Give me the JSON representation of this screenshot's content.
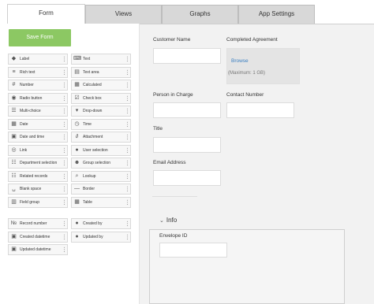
{
  "tabs": [
    {
      "label": "Form",
      "active": true
    },
    {
      "label": "Views",
      "active": false
    },
    {
      "label": "Graphs",
      "active": false
    },
    {
      "label": "App Settings",
      "active": false
    }
  ],
  "save_button": "Save Form",
  "palette": [
    {
      "label": "Label",
      "icon": "tag-icon"
    },
    {
      "label": "Text",
      "icon": "text-icon"
    },
    {
      "label": "Rich text",
      "icon": "rich-text-icon"
    },
    {
      "label": "Text area",
      "icon": "text-area-icon"
    },
    {
      "label": "Number",
      "icon": "number-icon"
    },
    {
      "label": "Calculated",
      "icon": "calculator-icon"
    },
    {
      "label": "Radio button",
      "icon": "radio-icon"
    },
    {
      "label": "Check box",
      "icon": "checkbox-icon"
    },
    {
      "label": "Multi-choice",
      "icon": "list-icon"
    },
    {
      "label": "Drop-down",
      "icon": "dropdown-icon"
    },
    {
      "label": "Date",
      "icon": "calendar-icon"
    },
    {
      "label": "Time",
      "icon": "clock-icon"
    },
    {
      "label": "Date and time",
      "icon": "calendar-clock-icon"
    },
    {
      "label": "Attachment",
      "icon": "paperclip-icon"
    },
    {
      "label": "Link",
      "icon": "globe-icon"
    },
    {
      "label": "User selection",
      "icon": "user-icon"
    },
    {
      "label": "Department selection",
      "icon": "department-icon"
    },
    {
      "label": "Group selection",
      "icon": "group-icon"
    },
    {
      "label": "Related records",
      "icon": "related-records-icon"
    },
    {
      "label": "Lookup",
      "icon": "lookup-icon"
    },
    {
      "label": "Blank space",
      "icon": "blank-space-icon"
    },
    {
      "label": "Border",
      "icon": "border-icon"
    },
    {
      "label": "Field group",
      "icon": "field-group-icon"
    },
    {
      "label": "Table",
      "icon": "table-icon"
    }
  ],
  "system_fields": [
    {
      "label": "Record number",
      "icon": "record-number-icon"
    },
    {
      "label": "Created by",
      "icon": "user-icon"
    },
    {
      "label": "Created datetime",
      "icon": "calendar-clock-icon"
    },
    {
      "label": "Updated by",
      "icon": "user-icon"
    },
    {
      "label": "Updated datetime",
      "icon": "calendar-clock-icon"
    }
  ],
  "form": {
    "customer_name": "Customer Name",
    "completed_agreement": "Completed Agreement",
    "browse": "Browse",
    "max_size": "(Maximum: 1 GB)",
    "person_in_charge": "Person in Charge",
    "contact_number": "Contact Number",
    "title": "Title",
    "email_address": "Email Address",
    "info_group": "Info",
    "envelope_id": "Envelope ID"
  },
  "colors": {
    "save_button": "#8cc863",
    "link": "#3a7fc1",
    "canvas": "#f2f2f2"
  }
}
